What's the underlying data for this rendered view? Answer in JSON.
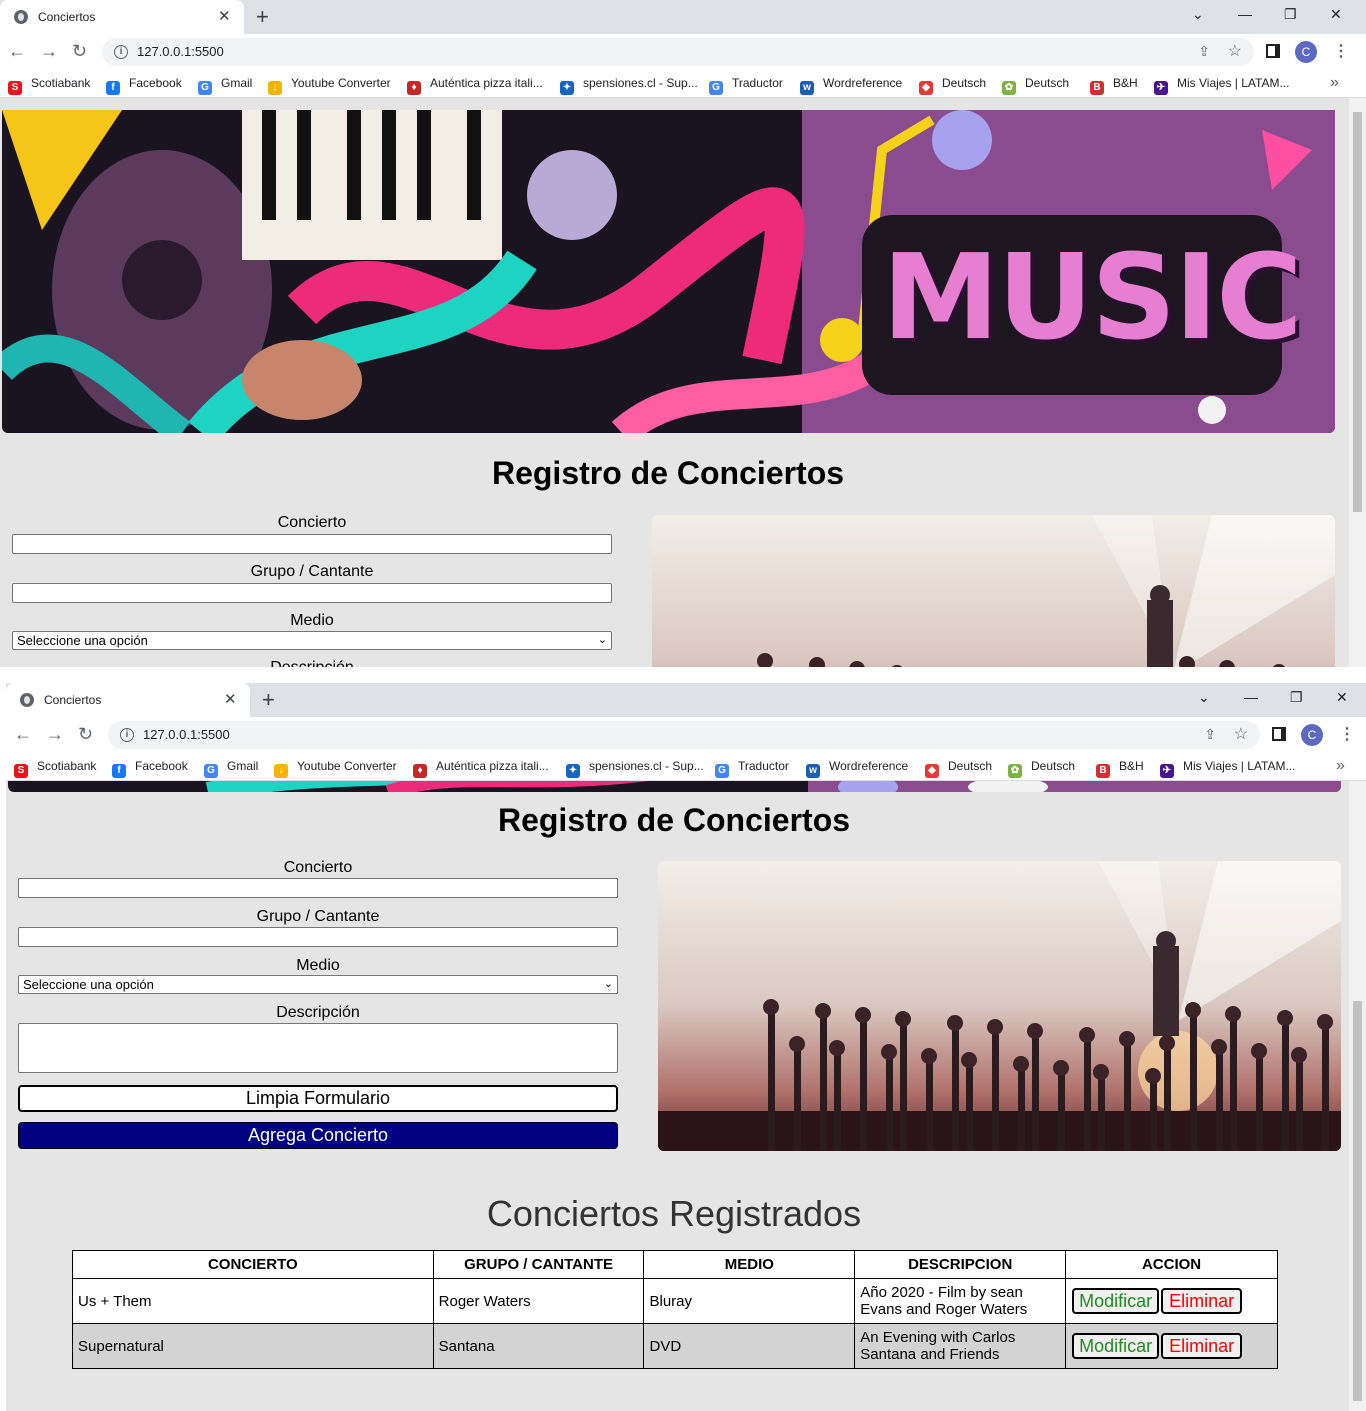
{
  "browser": {
    "tab_title": "Conciertos",
    "tab_close": "✕",
    "new_tab": "+",
    "url": "127.0.0.1:5500",
    "avatar_letter": "C",
    "window_controls": {
      "dropdown": "⌄",
      "minimize": "—",
      "restore": "❐",
      "close": "✕"
    },
    "bookmarks": [
      {
        "label": "Scotiabank",
        "icon": "S",
        "color": "#ec111a"
      },
      {
        "label": "Facebook",
        "icon": "f",
        "color": "#1877f2"
      },
      {
        "label": "Gmail",
        "icon": "G",
        "color": "#4285f4"
      },
      {
        "label": "Youtube Converter",
        "icon": "↓",
        "color": "#f4b400"
      },
      {
        "label": "Auténtica pizza itali...",
        "icon": "♦",
        "color": "#c62828"
      },
      {
        "label": "spensiones.cl - Sup...",
        "icon": "✦",
        "color": "#1565c0"
      },
      {
        "label": "Traductor",
        "icon": "G",
        "color": "#4285f4"
      },
      {
        "label": "Wordreference",
        "icon": "w",
        "color": "#1a5fb4"
      },
      {
        "label": "Deutsch",
        "icon": "◆",
        "color": "#e53935"
      },
      {
        "label": "Deutsch",
        "icon": "✿",
        "color": "#7cb342"
      },
      {
        "label": "B&H",
        "icon": "B",
        "color": "#d32f2f"
      },
      {
        "label": "Mis Viajes | LATAM...",
        "icon": "✈",
        "color": "#4a148c"
      }
    ],
    "bookmarks_more": "»"
  },
  "banner": {
    "word": "MUSIC"
  },
  "page": {
    "title": "Registro de Conciertos",
    "form": {
      "concierto_label": "Concierto",
      "grupo_label": "Grupo / Cantante",
      "medio_label": "Medio",
      "medio_selected": "Seleccione una opción",
      "descripcion_label": "Descripción",
      "clear_button": "Limpia Formulario",
      "add_button": "Agrega Concierto"
    },
    "section_title": "Conciertos Registrados",
    "table": {
      "headers": [
        "CONCIERTO",
        "GRUPO / CANTANTE",
        "MEDIO",
        "DESCRIPCION",
        "ACCION"
      ],
      "rows": [
        {
          "concierto": "Us + Them",
          "grupo": "Roger Waters",
          "medio": "Bluray",
          "descripcion": "Año 2020 - Film by sean Evans and Roger Waters"
        },
        {
          "concierto": "Supernatural",
          "grupo": "Santana",
          "medio": "DVD",
          "descripcion": "An Evening with Carlos Santana and Friends"
        }
      ],
      "modify_label": "Modificar",
      "delete_label": "Eliminar"
    }
  }
}
